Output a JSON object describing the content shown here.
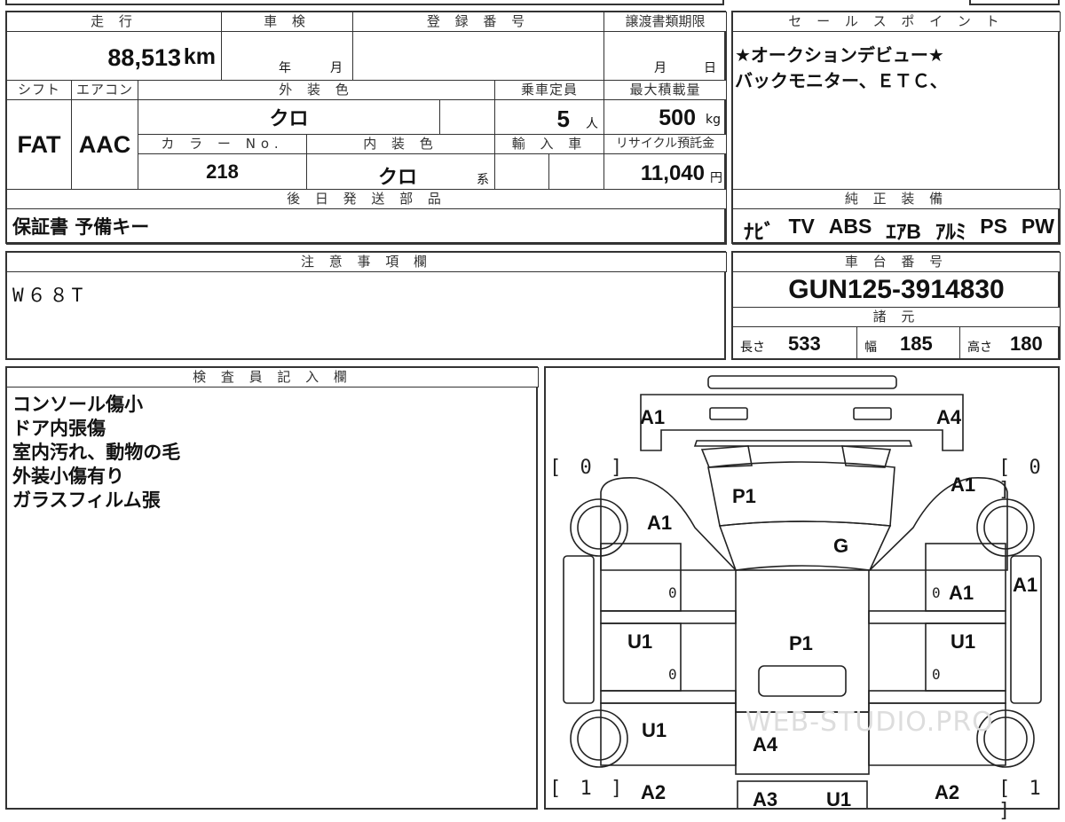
{
  "header": {
    "mileage_label": "走 行",
    "mileage_value": "88,513",
    "mileage_unit": "km",
    "inspection_label": "車 検",
    "inspection_year_unit": "年",
    "inspection_month_unit": "月",
    "registration_label": "登 録 番 号",
    "registration_value": "",
    "transfer_label": "譲渡書類期限",
    "transfer_month_unit": "月",
    "transfer_day_unit": "日"
  },
  "specs": {
    "shift_label": "シフト",
    "shift_value": "FAT",
    "ac_label": "エアコン",
    "ac_value": "AAC",
    "exterior_color_label": "外 装 色",
    "exterior_color_value": "クロ",
    "capacity_label": "乗車定員",
    "capacity_value": "5",
    "capacity_unit": "人",
    "max_load_label": "最大積載量",
    "max_load_value": "500",
    "max_load_unit": "kg",
    "color_no_label": "カ ラ ー No.",
    "color_no_value": "218",
    "interior_color_label": "内 装 色",
    "interior_color_value": "クロ",
    "interior_color_suffix": "系",
    "import_label": "輸 入 車",
    "recycle_label": "リサイクル預託金",
    "recycle_value": "11,040",
    "recycle_unit": "円"
  },
  "later_parts": {
    "label": "後 日 発 送 部 品",
    "value": "保証書 予備キー"
  },
  "sales_point": {
    "label": "セ ー ル ス ポ イ ン ト",
    "lines": [
      "★オークションデビュー★",
      "バックモニター、ＥＴＣ、"
    ]
  },
  "genuine_equipment": {
    "label": "純 正 装 備",
    "items": [
      "ﾅﾋﾞ",
      "TV",
      "ABS",
      "ｴｱB",
      "ｱﾙﾐ",
      "PS",
      "PW"
    ]
  },
  "notes": {
    "label": "注 意 事 項 欄",
    "value": "W６８T"
  },
  "chassis": {
    "label": "車 台 番 号",
    "value": "GUN125-3914830",
    "dims_label": "諸 元",
    "length_label": "長さ",
    "length_value": "533",
    "width_label": "幅",
    "width_value": "185",
    "height_label": "高さ",
    "height_value": "180"
  },
  "inspector": {
    "label": "検 査 員 記 入 欄",
    "lines": [
      "コンソール傷小",
      "ドア内張傷",
      "室内汚れ、動物の毛",
      "外装小傷有り",
      "ガラスフィルム張"
    ]
  },
  "diagram": {
    "marks": {
      "a1_front_left": "A1",
      "a4_front_right": "A4",
      "p1_hood": "P1",
      "a1_left_fender": "A1",
      "a1_right_fender": "A1",
      "g_windshield": "G",
      "zero_left_front_door": "0",
      "zero_right_front_door": "0",
      "a1_right_front_door": "A1",
      "a1_right_side": "A1",
      "u1_left_door": "U1",
      "u1_right_door": "U1",
      "p1_roof": "P1",
      "zero_left_rear_door": "0",
      "zero_right_rear_door": "0",
      "u1_left_rear": "U1",
      "a4_trunk": "A4",
      "a2_left_rear": "A2",
      "a2_right_rear": "A2",
      "a3_rear": "A3",
      "u1_rear": "U1"
    },
    "brackets": {
      "left_front": "[ 0 ]",
      "right_front": "[ 0 ]",
      "left_rear": "[ 1 ]",
      "right_rear": "[ 1 ]"
    },
    "watermark": "WEB-STUDIO.PRO"
  }
}
